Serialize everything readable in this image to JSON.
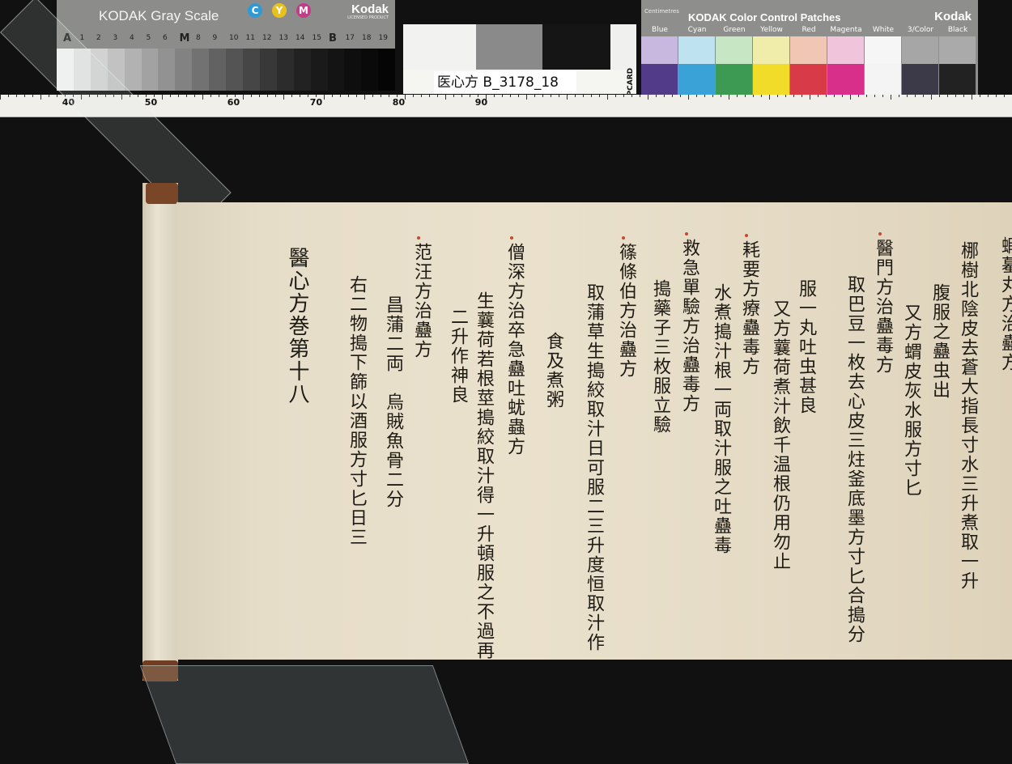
{
  "gray_card": {
    "title": "KODAK Gray Scale",
    "brand": "Kodak",
    "brand_sub": "LICENSED PRODUCT",
    "c": "C",
    "y": "Y",
    "m": "M",
    "scale": [
      "A",
      "1",
      "2",
      "3",
      "4",
      "5",
      "6",
      "M",
      "8",
      "9",
      "10",
      "11",
      "12",
      "13",
      "14",
      "15",
      "B",
      "17",
      "18",
      "19"
    ]
  },
  "qp_card": {
    "label": "医心方 B_3178_18",
    "qp": "QPCARD"
  },
  "color_card": {
    "title": "KODAK Color Control Patches",
    "brand": "Kodak",
    "cm": "Centimetres",
    "patches": [
      "Blue",
      "Cyan",
      "Green",
      "Yellow",
      "Red",
      "Magenta",
      "White",
      "3/Color",
      "Black"
    ],
    "colors_top": [
      "#c8b8e0",
      "#bfe2f0",
      "#c6e6c4",
      "#f0ecaa",
      "#f2c6b4",
      "#f0c4da",
      "#f6f6f6",
      "#a6a6a6",
      "#aaaaaa"
    ],
    "colors_bot": [
      "#523c8a",
      "#3aa2d6",
      "#3c9a52",
      "#f2dc2a",
      "#d83a48",
      "#d8308a",
      "#f4f4f4",
      "#3c3a48",
      "#222222"
    ]
  },
  "ruler": {
    "labels": [
      "40",
      "50",
      "60",
      "70",
      "80",
      "90"
    ]
  },
  "scroll": {
    "columns": [
      "蝦蟇丸方治蠱方",
      "梛樹北陰皮去蒼大指長寸水三升煮取一升",
      "腹服之蠱虫出",
      "又方蝟皮灰水服方寸匕",
      "醫門方治蠱毒方",
      "取巴豆一枚去心皮三炷釜底墨方寸匕合搗分",
      "服一丸吐虫甚良",
      "又方蘘荷煮汁飲千温根仍用勿止",
      "耗要方療蠱毒方",
      "水煮搗汁根一両取汁服之吐蠱毒",
      "救急單驗方治蠱毒方",
      "搗藥子三枚服立驗",
      "篠條伯方治蠱方",
      "取蒲草生搗絞取汁日可服二三升度恒取汁作",
      "食及煮粥",
      "僧深方治卒急蠱吐蚘蟲方",
      "生蘘荷若根莖搗絞取汁得一升頓服之不過再",
      "二升作神良",
      "范汪方治蠱方",
      "昌蒲二両　烏賊魚骨二分",
      "右二物搗下篩以酒服方寸匕日三",
      "醫心方巻第十八"
    ]
  }
}
